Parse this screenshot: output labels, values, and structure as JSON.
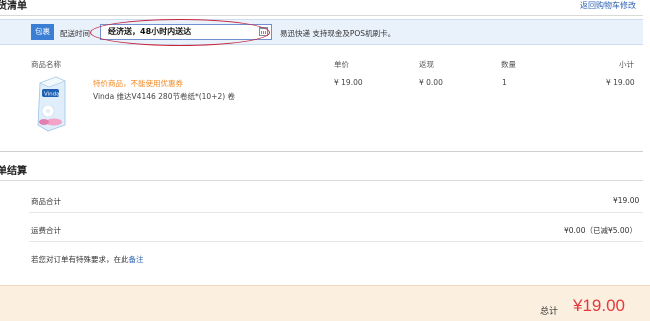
{
  "header": {
    "section_title": "货清单",
    "back_link": "返回购物车修改"
  },
  "package": {
    "badge": "包裹",
    "delivery_label": "配送时间",
    "delivery_value": "经济送，48小时内送达",
    "calendar_icon": "calendar-icon",
    "express_note": "易迅快递 支持现金及POS机刷卡。"
  },
  "cart_table": {
    "columns": {
      "name": "商品名称",
      "unit_price": "单价",
      "rebate": "返现",
      "quantity": "数量",
      "subtotal": "小计"
    },
    "items": [
      {
        "promo_note": "特价商品，不能使用优惠券",
        "name": "Vinda 维达V4146 280节卷纸*(10+2) 卷",
        "unit_price": "¥ 19.00",
        "rebate": "¥ 0.00",
        "quantity": "1",
        "subtotal": "¥ 19.00"
      }
    ]
  },
  "settlement": {
    "section_title": "单结算",
    "goods_total_label": "商品合计",
    "goods_total_value": "¥19.00",
    "shipping_label": "运费合计",
    "shipping_value": "¥0.00（已减¥5.00）",
    "remark_prefix": "若您对订单有特殊要求，在此",
    "remark_link": "备注"
  },
  "total": {
    "label": "总计",
    "value": "¥19.00"
  },
  "colors": {
    "accent_blue": "#3b7fd4",
    "link_blue": "#2b5fb3",
    "promo_orange": "#f08a24",
    "price_red": "#e4393c",
    "annotation_red": "#c8243a",
    "total_bar_bg": "#fbefe0"
  }
}
